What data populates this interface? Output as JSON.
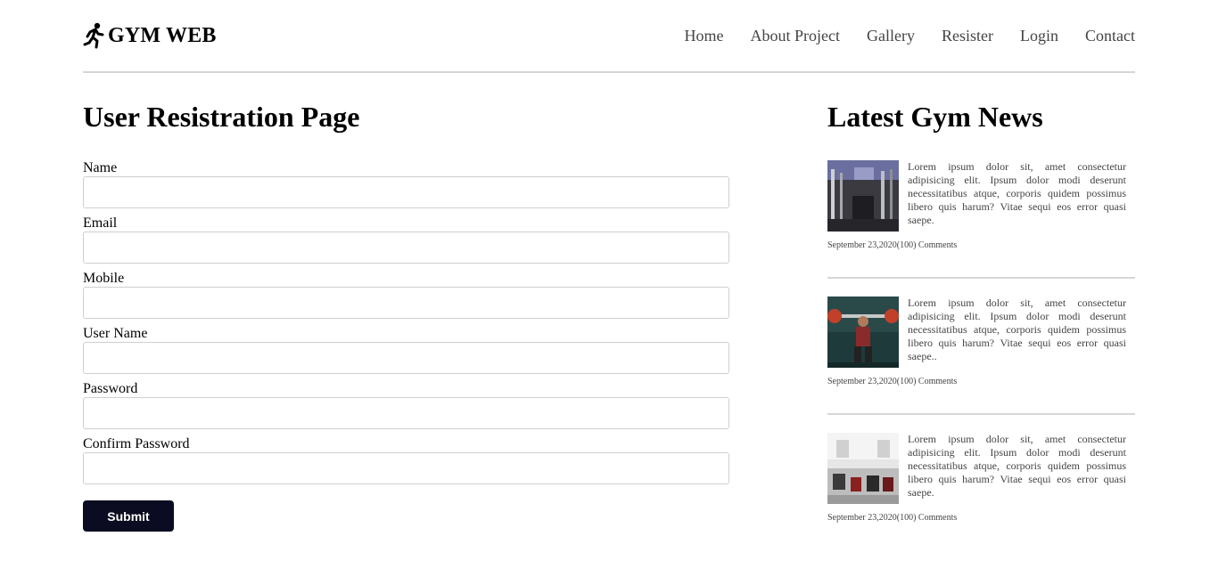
{
  "header": {
    "logo_text": "GYM WEB",
    "nav": [
      "Home",
      "About Project",
      "Gallery",
      "Resister",
      "Login",
      "Contact"
    ]
  },
  "main": {
    "title": "User Resistration Page",
    "fields": [
      {
        "label": "Name",
        "value": ""
      },
      {
        "label": "Email",
        "value": ""
      },
      {
        "label": "Mobile",
        "value": ""
      },
      {
        "label": "User Name",
        "value": ""
      },
      {
        "label": "Password",
        "value": ""
      },
      {
        "label": "Confirm Password",
        "value": ""
      }
    ],
    "submit_label": "Submit"
  },
  "aside": {
    "title": "Latest Gym News",
    "news": [
      {
        "text": "Lorem ipsum dolor sit, amet consectetur adipisicing elit. Ipsum dolor modi deserunt necessitatibus atque, corporis quidem possimus libero quis harum? Vitae sequi eos error quasi saepe.",
        "meta": "September 23,2020(100) Comments"
      },
      {
        "text": "Lorem ipsum dolor sit, amet consectetur adipisicing elit. Ipsum dolor modi deserunt necessitatibus atque, corporis quidem possimus libero quis harum? Vitae sequi eos error quasi saepe..",
        "meta": "September 23,2020(100) Comments"
      },
      {
        "text": "Lorem ipsum dolor sit, amet consectetur adipisicing elit. Ipsum dolor modi deserunt necessitatibus atque, corporis quidem possimus libero quis harum? Vitae sequi eos error quasi saepe.",
        "meta": "September 23,2020(100) Comments"
      }
    ]
  },
  "colors": {
    "button": "#0b0b22",
    "divider": "#d6d6d6",
    "nav_text": "#444444"
  },
  "icons": {
    "logo": "running-person-icon"
  }
}
